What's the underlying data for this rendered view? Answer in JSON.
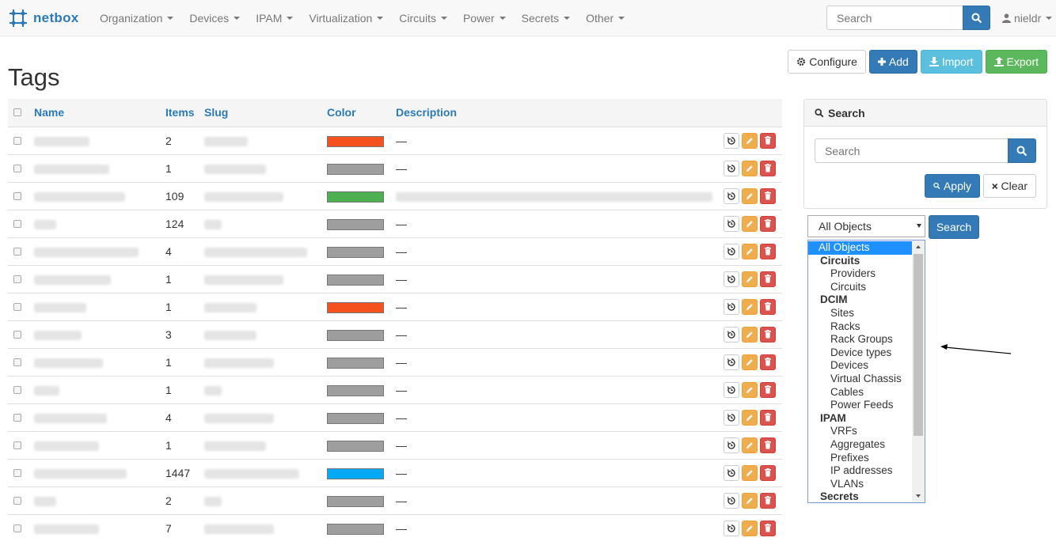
{
  "brand": {
    "name": "netbox"
  },
  "nav": {
    "items": [
      {
        "label": "Organization"
      },
      {
        "label": "Devices"
      },
      {
        "label": "IPAM"
      },
      {
        "label": "Virtualization"
      },
      {
        "label": "Circuits"
      },
      {
        "label": "Power"
      },
      {
        "label": "Secrets"
      },
      {
        "label": "Other"
      }
    ],
    "search_placeholder": "Search",
    "user": "nieldr"
  },
  "page": {
    "title": "Tags"
  },
  "actions": {
    "configure": "Configure",
    "add": "Add",
    "import": "Import",
    "export": "Export"
  },
  "table": {
    "headers": {
      "name": "Name",
      "items": "Items",
      "slug": "Slug",
      "color": "Color",
      "description": "Description"
    },
    "rows": [
      {
        "items": "2",
        "color": "#f4511e",
        "description": "—"
      },
      {
        "items": "1",
        "color": "#9e9e9e",
        "description": "—"
      },
      {
        "items": "109",
        "color": "#4caf50",
        "description": ""
      },
      {
        "items": "124",
        "color": "#9e9e9e",
        "description": "—"
      },
      {
        "items": "4",
        "color": "#9e9e9e",
        "description": "—"
      },
      {
        "items": "1",
        "color": "#9e9e9e",
        "description": "—"
      },
      {
        "items": "1",
        "color": "#f4511e",
        "description": "—"
      },
      {
        "items": "3",
        "color": "#9e9e9e",
        "description": "—"
      },
      {
        "items": "1",
        "color": "#9e9e9e",
        "description": "—"
      },
      {
        "items": "1",
        "color": "#9e9e9e",
        "description": "—"
      },
      {
        "items": "4",
        "color": "#9e9e9e",
        "description": "—"
      },
      {
        "items": "1",
        "color": "#9e9e9e",
        "description": "—"
      },
      {
        "items": "1447",
        "color": "#03a9f4",
        "description": "—"
      },
      {
        "items": "2",
        "color": "#9e9e9e",
        "description": "—"
      },
      {
        "items": "7",
        "color": "#9e9e9e",
        "description": "—"
      }
    ]
  },
  "search_panel": {
    "title": "Search",
    "placeholder": "Search",
    "apply": "Apply",
    "clear": "Clear"
  },
  "object_filter": {
    "selected": "All Objects",
    "search_button": "Search",
    "options": [
      {
        "label": "All Objects",
        "kind": "selected"
      },
      {
        "label": "Circuits",
        "kind": "group"
      },
      {
        "label": "Providers",
        "kind": "option"
      },
      {
        "label": "Circuits",
        "kind": "option"
      },
      {
        "label": "DCIM",
        "kind": "group"
      },
      {
        "label": "Sites",
        "kind": "option"
      },
      {
        "label": "Racks",
        "kind": "option"
      },
      {
        "label": "Rack Groups",
        "kind": "option"
      },
      {
        "label": "Device types",
        "kind": "option"
      },
      {
        "label": "Devices",
        "kind": "option"
      },
      {
        "label": "Virtual Chassis",
        "kind": "option"
      },
      {
        "label": "Cables",
        "kind": "option"
      },
      {
        "label": "Power Feeds",
        "kind": "option"
      },
      {
        "label": "IPAM",
        "kind": "group"
      },
      {
        "label": "VRFs",
        "kind": "option"
      },
      {
        "label": "Aggregates",
        "kind": "option"
      },
      {
        "label": "Prefixes",
        "kind": "option"
      },
      {
        "label": "IP addresses",
        "kind": "option"
      },
      {
        "label": "VLANs",
        "kind": "option"
      },
      {
        "label": "Secrets",
        "kind": "group"
      }
    ]
  },
  "colors": {
    "primary": "#337ab7",
    "link": "#2a7ab9",
    "success": "#5cb85c",
    "info": "#5bc0de",
    "warning": "#f0ad4e",
    "danger": "#d9534f"
  }
}
